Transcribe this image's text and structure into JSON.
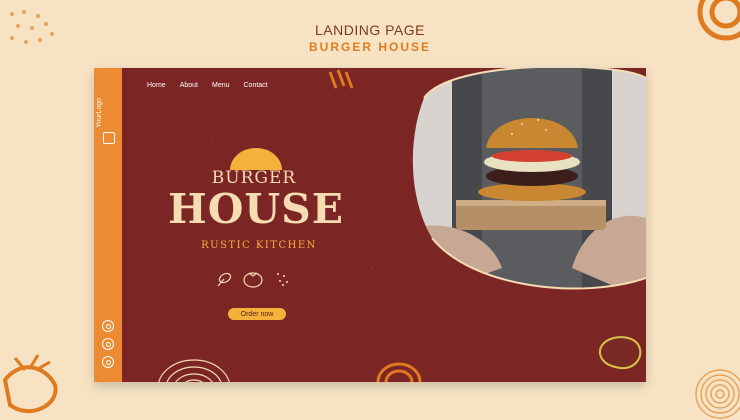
{
  "header": {
    "line1": "LANDING PAGE",
    "line2": "BURGER HOUSE"
  },
  "sidebar": {
    "logo_text": "YourLogo",
    "social_icons": [
      "instagram-icon",
      "facebook-icon",
      "twitter-icon"
    ]
  },
  "nav": {
    "items": [
      "Home",
      "About",
      "Menu",
      "Contact"
    ]
  },
  "hero": {
    "title_small": "BURGER",
    "title_large": "HOUSE",
    "subtitle": "RUSTIC KITCHEN",
    "cta_label": "Order now",
    "icons": [
      "leaf-icon",
      "tomato-icon",
      "sparkle-icon"
    ]
  },
  "colors": {
    "background": "#f7e3c4",
    "card": "#7c2525",
    "sidebar": "#ec8b32",
    "accent": "#f4b23a",
    "cream": "#f5dcb2"
  }
}
